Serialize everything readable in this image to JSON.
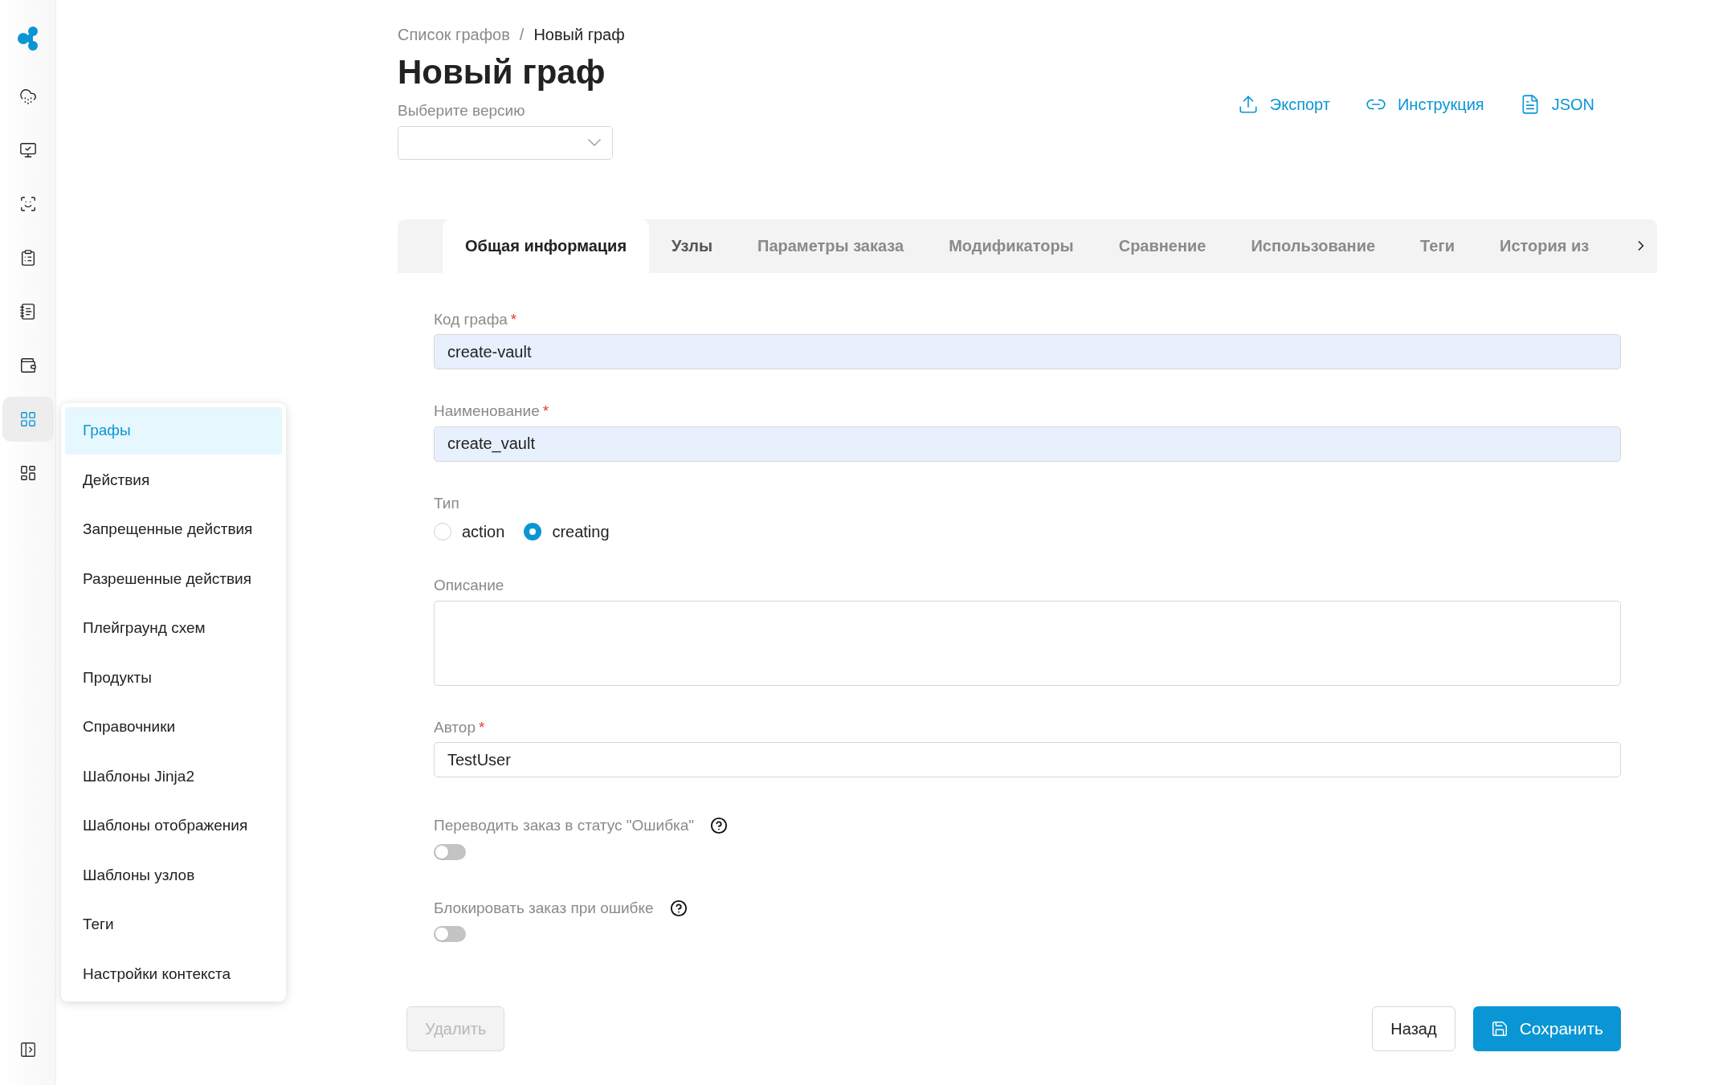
{
  "sidebar": {
    "items": [
      {
        "selected": false
      },
      {
        "selected": false
      },
      {
        "selected": false
      },
      {
        "selected": false
      },
      {
        "selected": false
      },
      {
        "selected": false
      },
      {
        "selected": true
      },
      {
        "selected": false
      }
    ]
  },
  "flyout_menu": {
    "items": [
      {
        "label": "Графы",
        "selected": true
      },
      {
        "label": "Действия",
        "selected": false
      },
      {
        "label": "Запрещенные действия",
        "selected": false
      },
      {
        "label": "Разрешенные действия",
        "selected": false
      },
      {
        "label": "Плейграунд схем",
        "selected": false
      },
      {
        "label": "Продукты",
        "selected": false
      },
      {
        "label": "Справочники",
        "selected": false
      },
      {
        "label": "Шаблоны Jinja2",
        "selected": false
      },
      {
        "label": "Шаблоны отображения",
        "selected": false
      },
      {
        "label": "Шаблоны узлов",
        "selected": false
      },
      {
        "label": "Теги",
        "selected": false
      },
      {
        "label": "Настройки контекста",
        "selected": false
      }
    ]
  },
  "breadcrumbs": [
    "Список графов",
    "Новый граф"
  ],
  "breadcrumb_separator": "/",
  "title": "Новый граф",
  "version_select": {
    "label": "Выберите версию"
  },
  "actions": [
    {
      "kind": "export",
      "label": "Экспорт"
    },
    {
      "kind": "link",
      "label": "Инструкция"
    },
    {
      "kind": "file",
      "label": "JSON"
    }
  ],
  "tabs": [
    {
      "label": "Общая информация",
      "selected": true
    },
    {
      "label": "Узлы",
      "selected": false
    },
    {
      "label": "Параметры заказа",
      "selected": false
    },
    {
      "label": "Модификаторы",
      "selected": false
    },
    {
      "label": "Сравнение",
      "selected": false
    },
    {
      "label": "Использование",
      "selected": false
    },
    {
      "label": "Теги",
      "selected": false
    },
    {
      "label": "История из",
      "selected": false
    }
  ],
  "form": [
    {
      "kind": "text",
      "label": "Код графа",
      "required_mark": "*",
      "value": "create-vault",
      "autofilled": true
    },
    {
      "kind": "text",
      "label": "Наименование",
      "required_mark": "*",
      "value": "create_vault",
      "autofilled": true
    },
    {
      "kind": "radio",
      "label": "Тип",
      "options": [
        {
          "label": "action",
          "selected": false
        },
        {
          "label": "creating",
          "selected": true
        }
      ]
    },
    {
      "kind": "textarea",
      "label": "Описание"
    },
    {
      "kind": "text",
      "label": "Автор",
      "required_mark": "*",
      "value": "TestUser",
      "autofilled": false
    },
    {
      "kind": "toggle",
      "label": "Переводить заказ в статус \"Ошибка\"",
      "on": false
    },
    {
      "kind": "toggle",
      "label": "Блокировать заказ при ошибке",
      "on": false
    }
  ],
  "buttons": {
    "delete": {
      "label": "Удалить",
      "disabled": true
    },
    "back": {
      "label": "Назад"
    },
    "save": {
      "label": "Сохранить"
    }
  }
}
